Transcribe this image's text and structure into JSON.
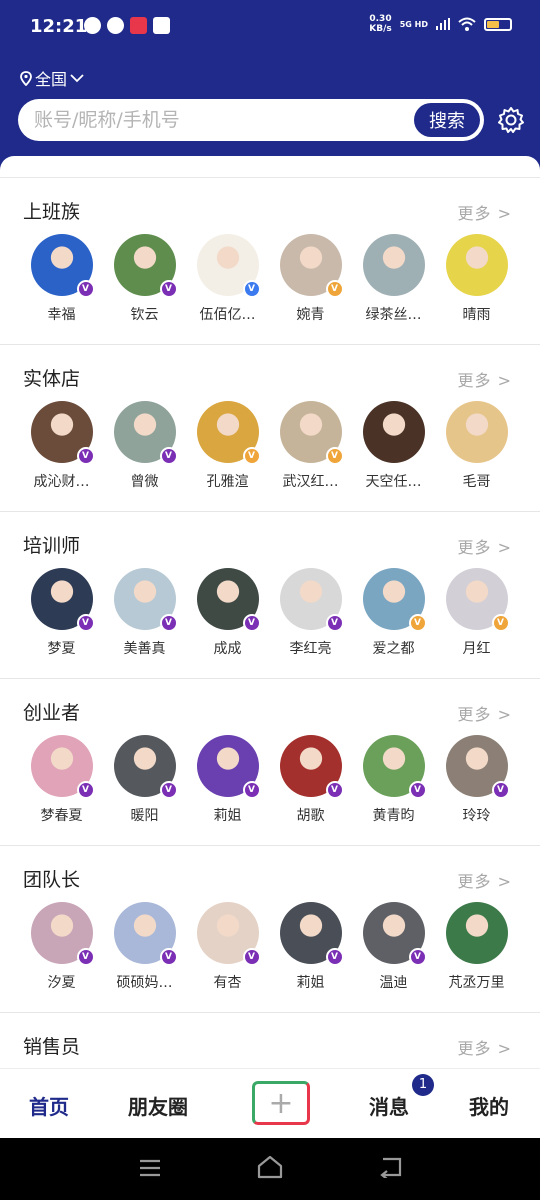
{
  "status_bar": {
    "time": "12:21",
    "net_speed": "0.30",
    "net_unit": "KB/s",
    "signal": "5G HD"
  },
  "header": {
    "location": "全国",
    "search_placeholder": "账号/昵称/手机号",
    "search_button": "搜索"
  },
  "sections": [
    {
      "title": "上班族",
      "more": "更多 >",
      "members": [
        {
          "name": "幸福",
          "badge": "purple",
          "color": "#2a62c8"
        },
        {
          "name": "钦云",
          "badge": "purple",
          "color": "#5f8d4e"
        },
        {
          "name": "伍佰亿…",
          "badge": "blue",
          "color": "#f3efe6"
        },
        {
          "name": "婉青",
          "badge": "gold",
          "color": "#c9b9aa"
        },
        {
          "name": "绿茶丝…",
          "badge": "",
          "color": "#9fb0b5"
        },
        {
          "name": "晴雨",
          "badge": "",
          "color": "#e6d44b"
        }
      ]
    },
    {
      "title": "实体店",
      "more": "更多 >",
      "members": [
        {
          "name": "成沁财…",
          "badge": "purple",
          "color": "#6b4b3a"
        },
        {
          "name": "曾微",
          "badge": "purple",
          "color": "#8fa39a"
        },
        {
          "name": "孔雅渲",
          "badge": "gold",
          "color": "#d9a640"
        },
        {
          "name": "武汉红…",
          "badge": "gold",
          "color": "#c6b49a"
        },
        {
          "name": "天空任…",
          "badge": "",
          "color": "#4a3326"
        },
        {
          "name": "毛哥",
          "badge": "",
          "color": "#e6c58a"
        }
      ]
    },
    {
      "title": "培训师",
      "more": "更多 >",
      "members": [
        {
          "name": "梦夏",
          "badge": "purple",
          "color": "#2d3b55"
        },
        {
          "name": "美善真",
          "badge": "purple",
          "color": "#b7c9d4"
        },
        {
          "name": "成成",
          "badge": "purple",
          "color": "#3f4a45"
        },
        {
          "name": "李红亮",
          "badge": "purple",
          "color": "#d8d8d8"
        },
        {
          "name": "爱之都",
          "badge": "gold",
          "color": "#7aa6c2"
        },
        {
          "name": "月红",
          "badge": "gold",
          "color": "#d2cfd6"
        }
      ]
    },
    {
      "title": "创业者",
      "more": "更多 >",
      "members": [
        {
          "name": "梦春夏",
          "badge": "purple",
          "color": "#e0a3b8"
        },
        {
          "name": "暖阳",
          "badge": "purple",
          "color": "#55595d"
        },
        {
          "name": "莉姐",
          "badge": "purple",
          "color": "#6a3fb0"
        },
        {
          "name": "胡歌",
          "badge": "purple",
          "color": "#a3302c"
        },
        {
          "name": "黄青昀",
          "badge": "purple",
          "color": "#6aa05a"
        },
        {
          "name": "玲玲",
          "badge": "purple",
          "color": "#8c8076"
        }
      ]
    },
    {
      "title": "团队长",
      "more": "更多 >",
      "members": [
        {
          "name": "汐夏",
          "badge": "purple",
          "color": "#c8a5b7"
        },
        {
          "name": "硕硕妈…",
          "badge": "purple",
          "color": "#a9b8d8"
        },
        {
          "name": "有杏",
          "badge": "purple",
          "color": "#e5d2c6"
        },
        {
          "name": "莉姐",
          "badge": "purple",
          "color": "#4a4f57"
        },
        {
          "name": "温迪",
          "badge": "purple",
          "color": "#5e6066"
        },
        {
          "name": "芃丞万里",
          "badge": "",
          "color": "#3d7a4a"
        }
      ]
    },
    {
      "title": "销售员",
      "more": "更多 >",
      "members": []
    }
  ],
  "bottom_nav": {
    "home": "首页",
    "moments": "朋友圈",
    "plus": "+",
    "messages": "消息",
    "messages_badge": "1",
    "me": "我的"
  },
  "colors": {
    "brand": "#1f2a8a"
  }
}
